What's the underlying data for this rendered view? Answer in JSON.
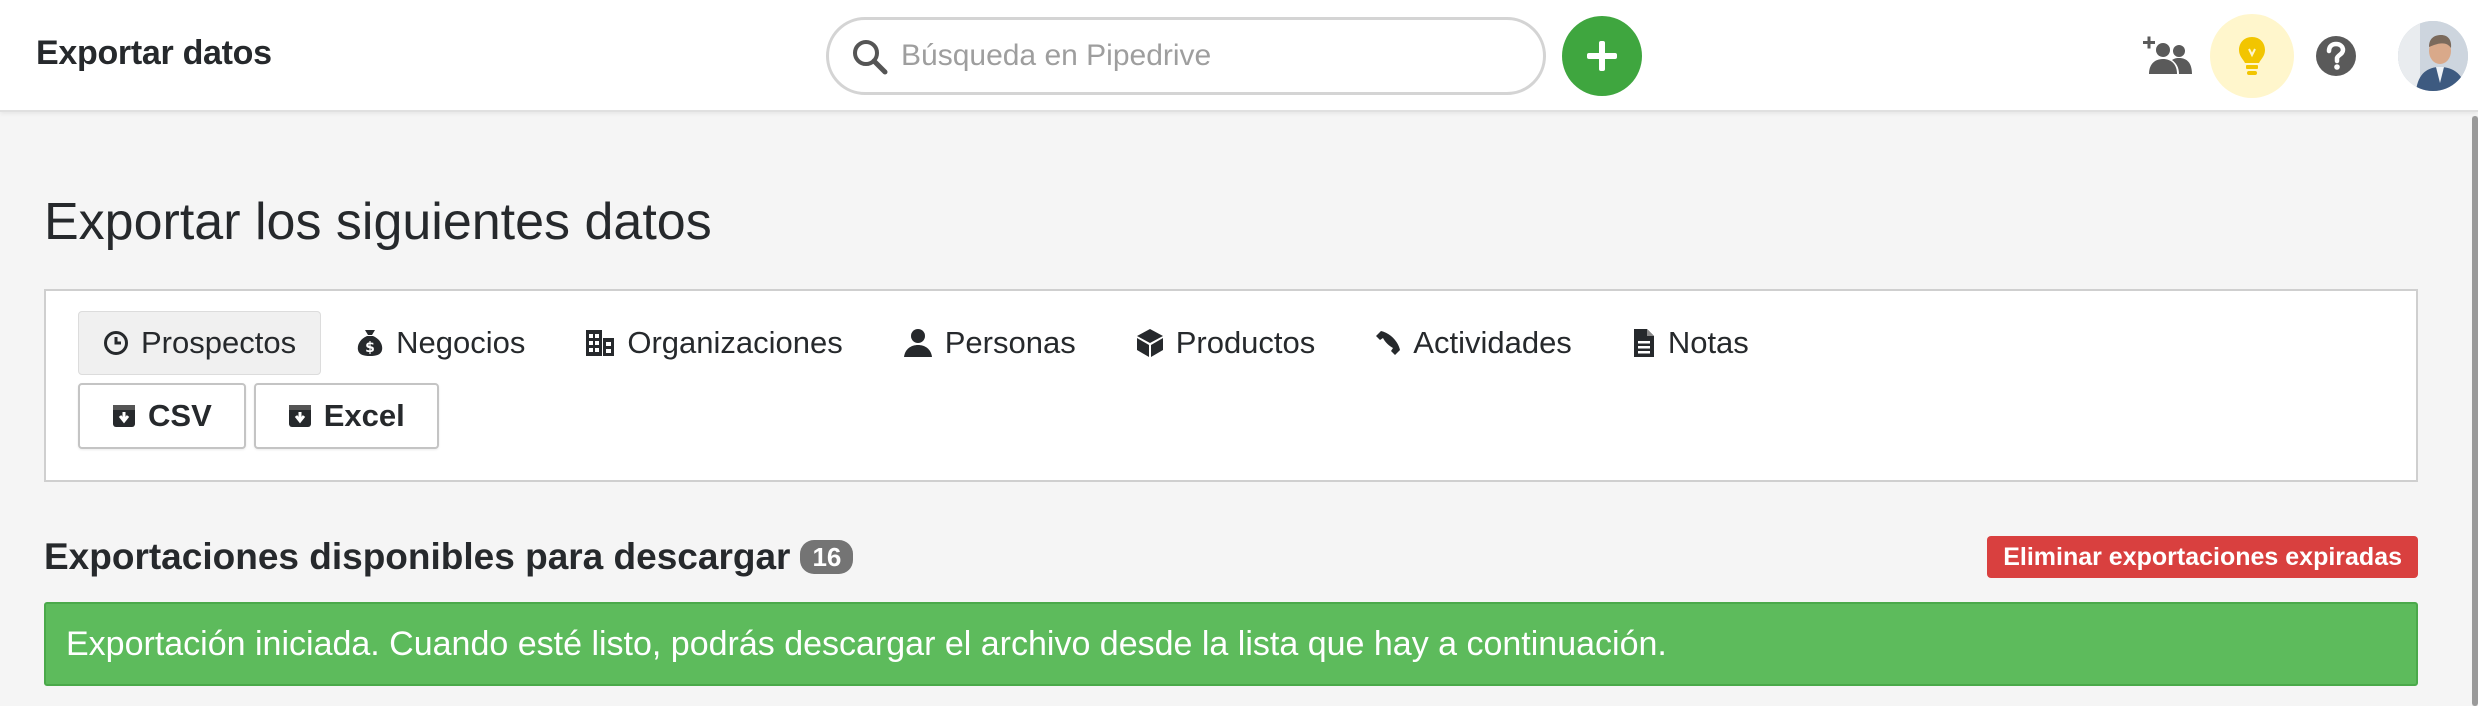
{
  "header": {
    "title": "Exportar datos",
    "search_placeholder": "Búsqueda en Pipedrive",
    "add_icon": "plus-icon",
    "invite_icon": "invite-users-icon",
    "ideas_icon": "lightbulb-icon",
    "help_icon": "help-icon"
  },
  "main": {
    "title": "Exportar los siguientes datos",
    "tabs": [
      {
        "label": "Prospectos",
        "icon": "clock-icon",
        "active": true
      },
      {
        "label": "Negocios",
        "icon": "money-bag-icon",
        "active": false
      },
      {
        "label": "Organizaciones",
        "icon": "building-icon",
        "active": false
      },
      {
        "label": "Personas",
        "icon": "person-icon",
        "active": false
      },
      {
        "label": "Productos",
        "icon": "box-icon",
        "active": false
      },
      {
        "label": "Actividades",
        "icon": "phone-icon",
        "active": false
      },
      {
        "label": "Notas",
        "icon": "document-icon",
        "active": false
      }
    ],
    "formats": [
      {
        "label": "CSV",
        "icon": "download-icon"
      },
      {
        "label": "Excel",
        "icon": "download-icon"
      }
    ]
  },
  "exports": {
    "heading": "Exportaciones disponibles para descargar",
    "count": "16",
    "delete_expired_label": "Eliminar exportaciones expiradas",
    "success_message": "Exportación iniciada. Cuando esté listo, podrás descargar el archivo desde la lista que hay a continuación."
  },
  "colors": {
    "primary_green": "#3fa63f",
    "success_green": "#5dbb5c",
    "danger_red": "#d9403f",
    "badge_gray": "#747474",
    "idea_yellow": "#f2c500"
  }
}
